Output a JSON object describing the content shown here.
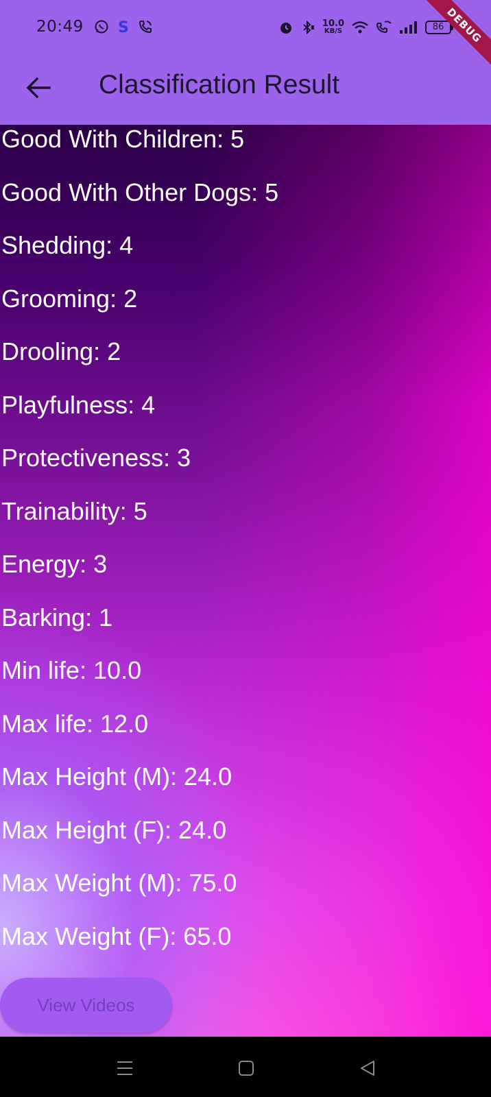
{
  "status_bar": {
    "time": "20:49",
    "network_speed_value": "10.0",
    "network_speed_unit": "KB/S",
    "battery": "86",
    "left_icons": [
      "whatsapp-icon",
      "s-app-icon",
      "phone-call-icon"
    ],
    "right_icons": [
      "alarm-icon",
      "bluetooth-icon",
      "wifi-icon",
      "wifi-calling-icon",
      "signal-icon",
      "battery-icon"
    ]
  },
  "debug_banner": "DEBUG",
  "app_bar": {
    "title": "Classification Result",
    "back_icon": "arrow-back-icon"
  },
  "traits": [
    "Good With Children: 5",
    "Good With Other Dogs: 5",
    "Shedding: 4",
    "Grooming: 2",
    "Drooling: 2",
    "Playfulness: 4",
    "Protectiveness: 3",
    "Trainability: 5",
    "Energy: 3",
    "Barking: 1",
    "Min life: 10.0",
    "Max life: 12.0",
    "Max Height (M): 24.0",
    "Max Height (F): 24.0",
    "Max Weight (M): 75.0",
    "Max Weight (F): 65.0"
  ],
  "actions": {
    "view_videos_label": "View Videos"
  },
  "nav_bar": {
    "icons": [
      "menu-icon",
      "home-square-icon",
      "back-triangle-icon"
    ]
  },
  "colors": {
    "app_bar": "#9b63ec",
    "button": "#a35af0",
    "button_text": "#7440c2",
    "debug_ribbon": "#a3164a"
  }
}
